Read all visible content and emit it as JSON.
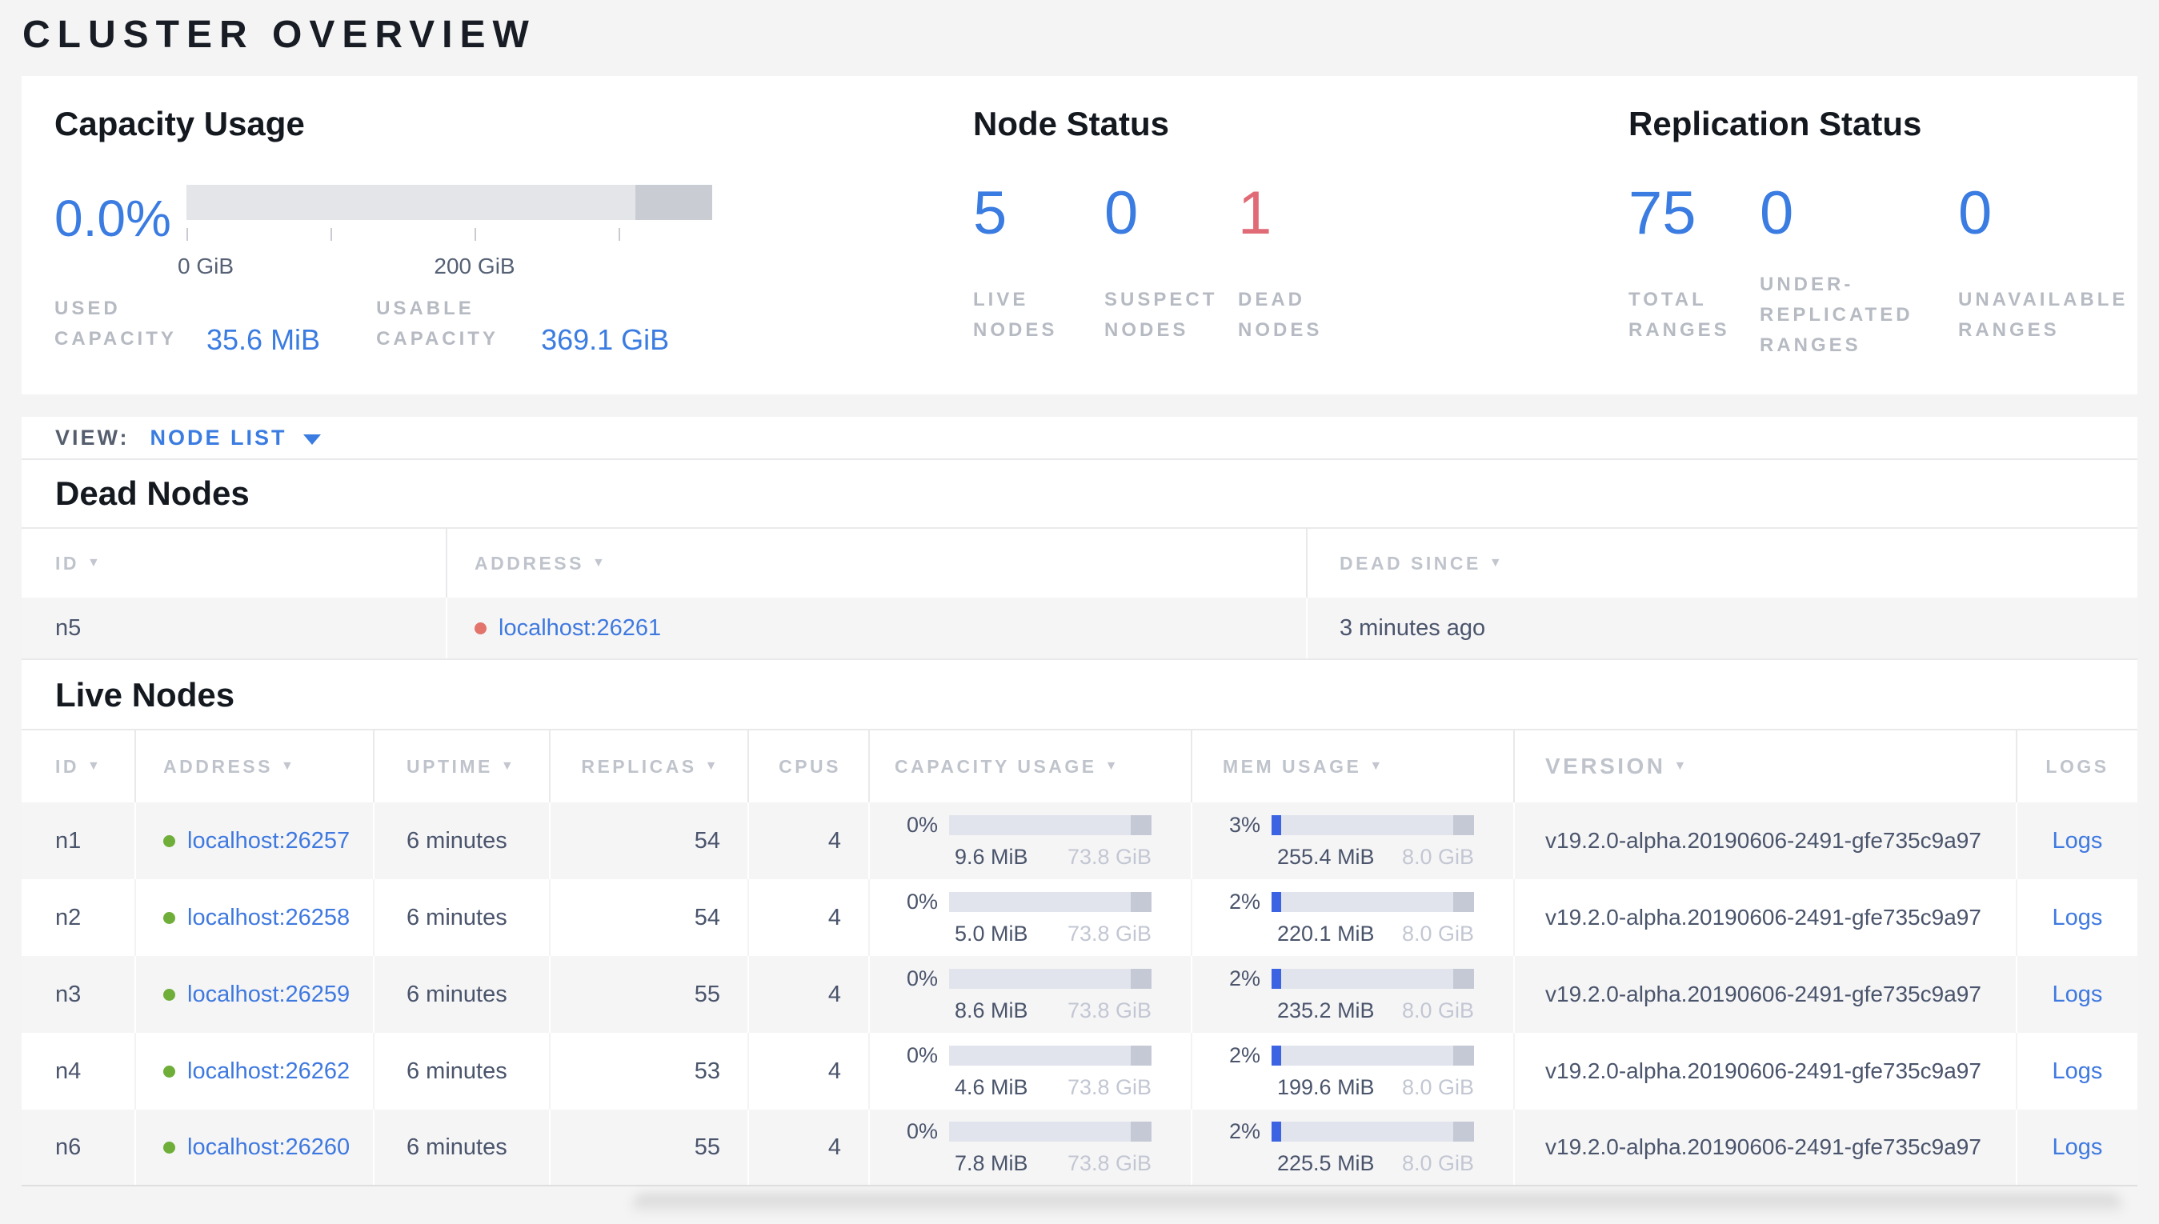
{
  "page": {
    "title": "CLUSTER OVERVIEW"
  },
  "ui": {
    "sort_icon": "▼"
  },
  "colors": {
    "accent_blue": "#3a7ce1",
    "link_blue": "#3f79df",
    "mem_fill_blue": "#3b63e2",
    "dead_red": "#e06a76",
    "dead_dot_red": "#e2746b",
    "live_dot_green": "#6fae38",
    "bar_light_gray": "#e3e5e9",
    "bar_dark_gray": "#caccd4",
    "label_gray": "#b6bac2",
    "page_background": "#f4f4f4"
  },
  "summary": {
    "capacity": {
      "title": "Capacity Usage",
      "percent": "0.0%",
      "ticks": [
        "0 GiB",
        "200 GiB"
      ],
      "used": {
        "label": "USED CAPACITY",
        "value": "35.6 MiB"
      },
      "usable": {
        "label": "USABLE CAPACITY",
        "value": "369.1 GiB"
      }
    },
    "node_status": {
      "title": "Node Status",
      "stats": [
        {
          "value": "5",
          "label": "LIVE NODES"
        },
        {
          "value": "0",
          "label": "SUSPECT NODES"
        },
        {
          "value": "1",
          "label": "DEAD NODES"
        }
      ]
    },
    "replication": {
      "title": "Replication Status",
      "stats": [
        {
          "value": "75",
          "label": "TOTAL RANGES"
        },
        {
          "value": "0",
          "label": "UNDER-REPLICATED RANGES"
        },
        {
          "value": "0",
          "label": "UNAVAILABLE RANGES"
        }
      ]
    }
  },
  "view_bar": {
    "label": "VIEW:",
    "selected": "NODE LIST"
  },
  "dead_nodes": {
    "title": "Dead Nodes",
    "columns": [
      "ID",
      "ADDRESS",
      "DEAD SINCE"
    ],
    "rows": [
      {
        "id": "n5",
        "address": "localhost:26261",
        "dead_since": "3 minutes ago"
      }
    ]
  },
  "live_nodes": {
    "title": "Live Nodes",
    "columns": [
      "ID",
      "ADDRESS",
      "UPTIME",
      "REPLICAS",
      "CPUS",
      "CAPACITY USAGE",
      "MEM USAGE",
      "VERSION",
      "LOGS"
    ],
    "rows": [
      {
        "id": "n1",
        "address": "localhost:26257",
        "uptime": "6 minutes",
        "replicas": "54",
        "cpus": "4",
        "capacity": {
          "percent": "0%",
          "used": "9.6 MiB",
          "total": "73.8 GiB"
        },
        "memory": {
          "percent": "3%",
          "used": "255.4 MiB",
          "total": "8.0 GiB"
        },
        "version": "v19.2.0-alpha.20190606-2491-gfe735c9a97",
        "logs": "Logs"
      },
      {
        "id": "n2",
        "address": "localhost:26258",
        "uptime": "6 minutes",
        "replicas": "54",
        "cpus": "4",
        "capacity": {
          "percent": "0%",
          "used": "5.0 MiB",
          "total": "73.8 GiB"
        },
        "memory": {
          "percent": "2%",
          "used": "220.1 MiB",
          "total": "8.0 GiB"
        },
        "version": "v19.2.0-alpha.20190606-2491-gfe735c9a97",
        "logs": "Logs"
      },
      {
        "id": "n3",
        "address": "localhost:26259",
        "uptime": "6 minutes",
        "replicas": "55",
        "cpus": "4",
        "capacity": {
          "percent": "0%",
          "used": "8.6 MiB",
          "total": "73.8 GiB"
        },
        "memory": {
          "percent": "2%",
          "used": "235.2 MiB",
          "total": "8.0 GiB"
        },
        "version": "v19.2.0-alpha.20190606-2491-gfe735c9a97",
        "logs": "Logs"
      },
      {
        "id": "n4",
        "address": "localhost:26262",
        "uptime": "6 minutes",
        "replicas": "53",
        "cpus": "4",
        "capacity": {
          "percent": "0%",
          "used": "4.6 MiB",
          "total": "73.8 GiB"
        },
        "memory": {
          "percent": "2%",
          "used": "199.6 MiB",
          "total": "8.0 GiB"
        },
        "version": "v19.2.0-alpha.20190606-2491-gfe735c9a97",
        "logs": "Logs"
      },
      {
        "id": "n6",
        "address": "localhost:26260",
        "uptime": "6 minutes",
        "replicas": "55",
        "cpus": "4",
        "capacity": {
          "percent": "0%",
          "used": "7.8 MiB",
          "total": "73.8 GiB"
        },
        "memory": {
          "percent": "2%",
          "used": "225.5 MiB",
          "total": "8.0 GiB"
        },
        "version": "v19.2.0-alpha.20190606-2491-gfe735c9a97",
        "logs": "Logs"
      }
    ]
  }
}
